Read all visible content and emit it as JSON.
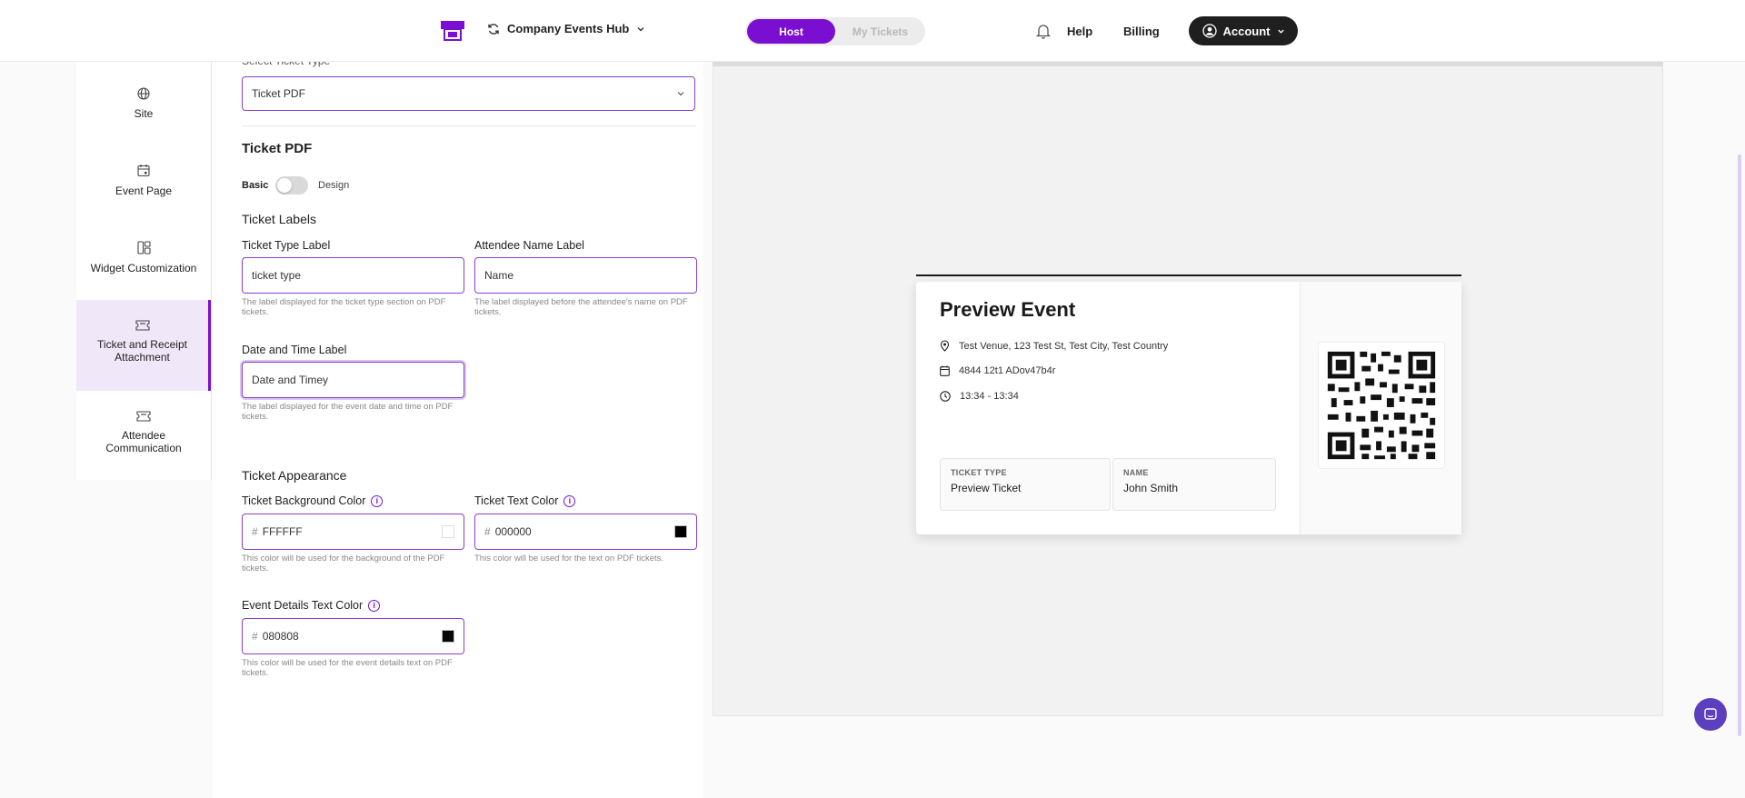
{
  "header": {
    "workspace": "Company Events Hub",
    "tabs": [
      {
        "label": "Host",
        "active": true
      },
      {
        "label": "My Tickets",
        "active": false
      }
    ],
    "help": "Help",
    "billing": "Billing",
    "account": "Account",
    "accent_color": "#7a0fd1"
  },
  "sidebar": {
    "items": [
      {
        "label": "Site",
        "icon": "globe-icon"
      },
      {
        "label": "Event Page",
        "icon": "calendar-icon"
      },
      {
        "label": "Widget Customization",
        "icon": "widget-icon"
      },
      {
        "label": "Ticket and Receipt Attachment",
        "icon": "ticket-icon",
        "active": true
      },
      {
        "label": "Attendee Communication",
        "icon": "ticket-icon"
      }
    ]
  },
  "form": {
    "select_label": "Select Ticket Type",
    "select_value": "Ticket PDF",
    "section_title": "Ticket PDF",
    "toggle_left": "Basic",
    "toggle_right": "Design",
    "labels_heading": "Ticket Labels",
    "ticket_type_label": "Ticket Type Label",
    "ticket_type_value": "ticket type",
    "ticket_type_help": "The label displayed for the ticket type section on PDF tickets.",
    "attendee_label": "Attendee Name Label",
    "attendee_value": "Name",
    "attendee_help": "The label displayed before the attendee's name on PDF tickets.",
    "datetime_label": "Date and Time Label",
    "datetime_value": "Date and Timey",
    "datetime_help": "The label displayed for the event date and time on PDF tickets.",
    "appearance_heading": "Ticket Appearance",
    "bg_label": "Ticket Background Color",
    "bg_value": "FFFFFF",
    "bg_help": "This color will be used for the background of the PDF tickets.",
    "text_label": "Ticket Text Color",
    "text_value": "000000",
    "text_help": "This color will be used for the text on PDF tickets.",
    "details_label": "Event Details Text Color",
    "details_value": "080808",
    "details_help": "This color will be used for the event details text on PDF tickets.",
    "hash": "#",
    "info_glyph": "i"
  },
  "preview": {
    "title": "Preview Event",
    "venue": "Test Venue, 123 Test St, Test City, Test Country",
    "date": "4844 12t1 ADov47b4r",
    "time": "13:34 - 13:34",
    "type_key": "TICKET TYPE",
    "type_value": "Preview Ticket",
    "name_key": "NAME",
    "name_value": "John Smith"
  }
}
